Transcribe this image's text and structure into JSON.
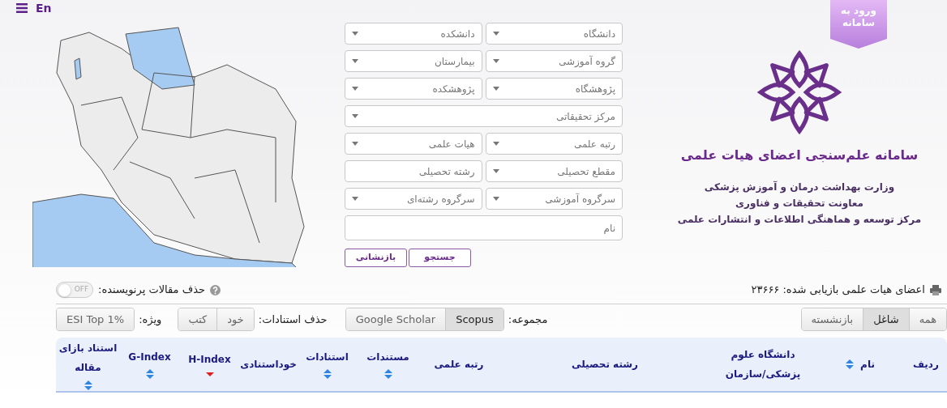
{
  "header": {
    "language_link": "En",
    "login_ribbon": "ورود به سامانه"
  },
  "branding": {
    "title": "سامانه علم‌سنجی اعضای هیات علمی",
    "subtitle_lines": [
      "وزارت بهداشت درمان و آموزش پزشکی",
      "معاونت تحقیقات و فناوری",
      "مرکز توسعه و هماهنگی اطلاعات و انتشارات علمی"
    ]
  },
  "filters": [
    [
      {
        "kind": "dropdown",
        "placeholder": "دانشگاه"
      },
      {
        "kind": "dropdown",
        "placeholder": "دانشکده"
      }
    ],
    [
      {
        "kind": "dropdown",
        "placeholder": "گروه آموزشی"
      },
      {
        "kind": "dropdown",
        "placeholder": "بیمارستان"
      }
    ],
    [
      {
        "kind": "dropdown",
        "placeholder": "پژوهشگاه"
      },
      {
        "kind": "dropdown",
        "placeholder": "پژوهشکده"
      }
    ],
    [
      {
        "kind": "dropdown",
        "placeholder": "مرکز تحقیقاتی"
      }
    ],
    [
      {
        "kind": "dropdown",
        "placeholder": "رتبه علمی"
      },
      {
        "kind": "dropdown",
        "placeholder": "هیات علمی"
      }
    ],
    [
      {
        "kind": "dropdown",
        "placeholder": "مقطع تحصیلی"
      },
      {
        "kind": "text",
        "placeholder": "رشته تحصیلی"
      }
    ],
    [
      {
        "kind": "dropdown",
        "placeholder": "سرگروه آموزشی"
      },
      {
        "kind": "dropdown",
        "placeholder": "سرگروه رشته‌ای"
      }
    ],
    [
      {
        "kind": "text",
        "placeholder": "نام"
      }
    ]
  ],
  "form_buttons": [
    "جستجو",
    "بازنشانی"
  ],
  "result_count": "اعضای هیات علمی بازیابی شده: ۲۳۶۶۶",
  "prolific_filter": {
    "label": "حذف مقالات پرنویسنده:",
    "on": false,
    "toggle_text": "OFF"
  },
  "status_tabs": [
    {
      "label": "همه",
      "selected": false
    },
    {
      "label": "شاغل",
      "selected": true
    },
    {
      "label": "بازنشسته",
      "selected": false
    }
  ],
  "collection": {
    "label": "مجموعه:",
    "options": [
      {
        "label": "Scopus",
        "selected": true
      },
      {
        "label": "Google Scholar",
        "selected": false
      }
    ]
  },
  "exclude_citations": {
    "label": "حذف استنادات:",
    "options": [
      {
        "label": "خود",
        "selected": false
      },
      {
        "label": "کتب",
        "selected": false
      }
    ]
  },
  "special": {
    "label": "ویژه:",
    "options": [
      {
        "label": "ESI Top 1%",
        "selected": false
      }
    ]
  },
  "table": {
    "columns": [
      {
        "label": "ردیف",
        "sortable": false
      },
      {
        "label": "نام",
        "sortable": true,
        "sorted_descending": false
      },
      {
        "label": "دانشگاه علوم پزشکی/سازمان",
        "sortable": false
      },
      {
        "label": "رشته تحصیلی",
        "sortable": false
      },
      {
        "label": "رتبه علمی",
        "sortable": false
      },
      {
        "label": "مستندات",
        "sortable": true,
        "sorted_descending": false
      },
      {
        "label": "استنادات",
        "sortable": true,
        "sorted_descending": false
      },
      {
        "label": "خوداستنادی",
        "sortable": false
      },
      {
        "label": "H-Index",
        "sortable": true,
        "sorted_descending": true
      },
      {
        "label": "G-Index",
        "sortable": true,
        "sorted_descending": false
      },
      {
        "label": "استناد بازای مقاله",
        "sortable": true,
        "sorted_descending": false
      }
    ]
  }
}
